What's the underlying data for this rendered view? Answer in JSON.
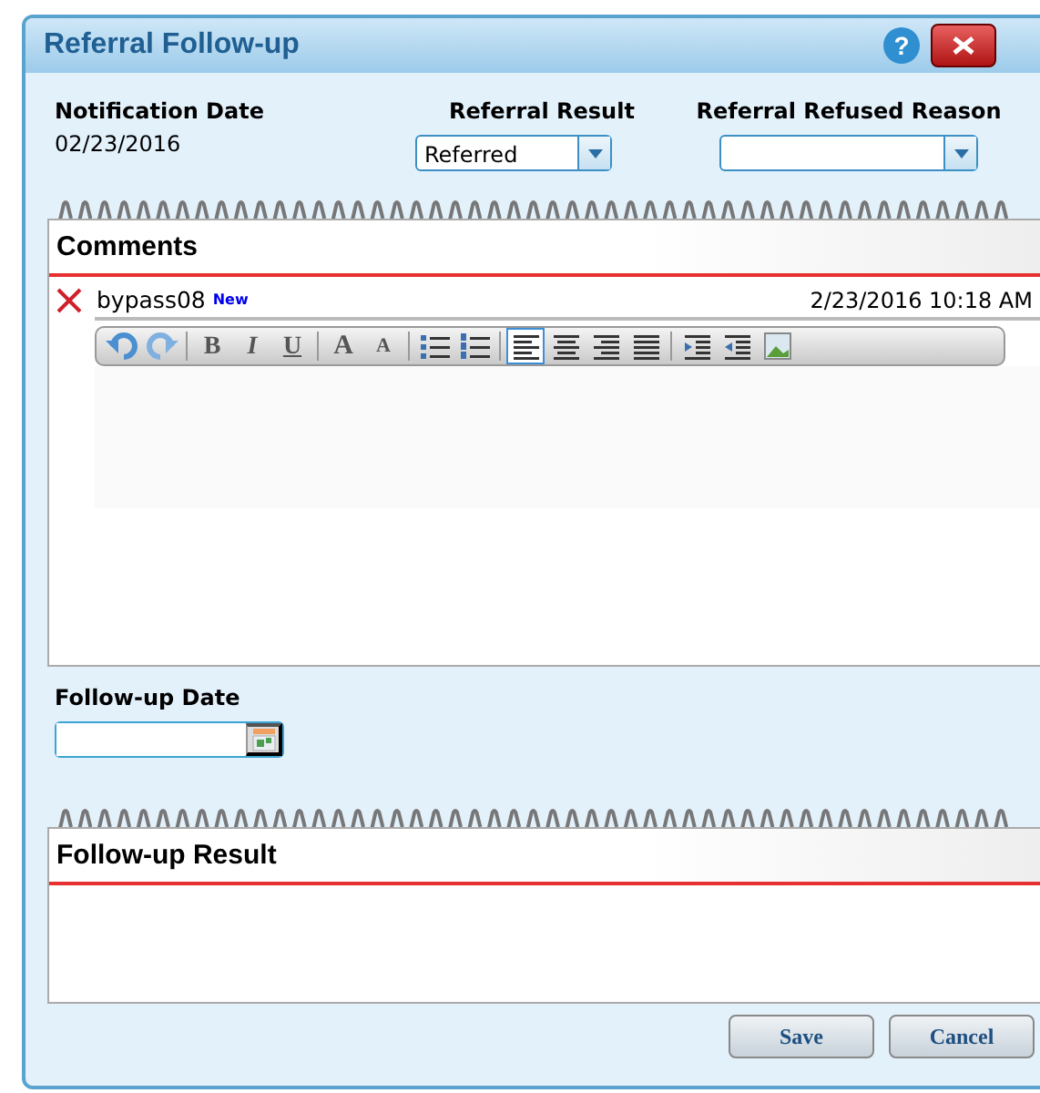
{
  "window": {
    "title": "Referral Follow-up",
    "help": "?"
  },
  "fields": [
    {
      "kind": "text",
      "label": "Notification Date",
      "value": "02/23/2016"
    },
    {
      "kind": "select",
      "label": "Referral Result",
      "value": "Referred"
    },
    {
      "kind": "select",
      "label": "Referral Refused Reason"
    }
  ],
  "comments": {
    "title": "Comments",
    "entries": [
      {
        "author": "bypass08",
        "badge": "New",
        "timestamp": "2/23/2016 10:18 AM"
      }
    ],
    "toolbar": [
      {
        "kind": "undo",
        "selected": false
      },
      {
        "kind": "redo",
        "selected": false
      },
      {
        "kind": "sep"
      },
      {
        "kind": "bold",
        "label": "B",
        "selected": false
      },
      {
        "kind": "italic",
        "label": "I",
        "selected": false
      },
      {
        "kind": "underline",
        "label": "U",
        "selected": false
      },
      {
        "kind": "sep"
      },
      {
        "kind": "grow",
        "label": "A",
        "selected": false
      },
      {
        "kind": "shrink",
        "label": "A",
        "selected": false
      },
      {
        "kind": "sep"
      },
      {
        "kind": "bullets",
        "selected": false
      },
      {
        "kind": "numbers",
        "selected": false
      },
      {
        "kind": "sep"
      },
      {
        "kind": "left",
        "selected": true
      },
      {
        "kind": "center",
        "selected": false
      },
      {
        "kind": "right",
        "selected": false
      },
      {
        "kind": "justify",
        "selected": false
      },
      {
        "kind": "sep"
      },
      {
        "kind": "indent",
        "selected": false
      },
      {
        "kind": "outdent",
        "selected": false
      },
      {
        "kind": "image",
        "selected": false
      }
    ]
  },
  "follow_up_date": {
    "label": "Follow-up Date"
  },
  "follow_up_result": {
    "title": "Follow-up Result"
  },
  "buttons": [
    "Save",
    "Cancel"
  ]
}
